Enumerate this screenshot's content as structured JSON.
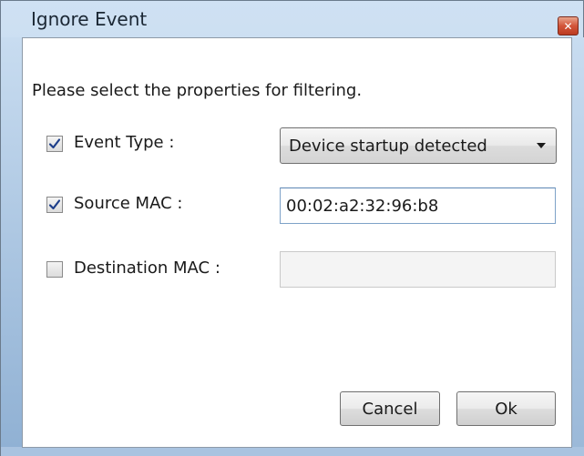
{
  "window": {
    "title": "Ignore Event",
    "close_icon": "close-icon"
  },
  "dialog": {
    "instruction": "Please select the properties for filtering.",
    "event_type": {
      "label": "Event Type :",
      "checked": true,
      "selected_value": "Device startup detected"
    },
    "source_mac": {
      "label": "Source MAC :",
      "checked": true,
      "value": "00:02:a2:32:96:b8"
    },
    "destination_mac": {
      "label": "Destination MAC :",
      "checked": false,
      "value": ""
    },
    "buttons": {
      "cancel": "Cancel",
      "ok": "Ok"
    }
  },
  "colors": {
    "title_bar": "#bcd3ec",
    "close_button": "#c94a2e",
    "checkmark": "#1e3f8a"
  }
}
